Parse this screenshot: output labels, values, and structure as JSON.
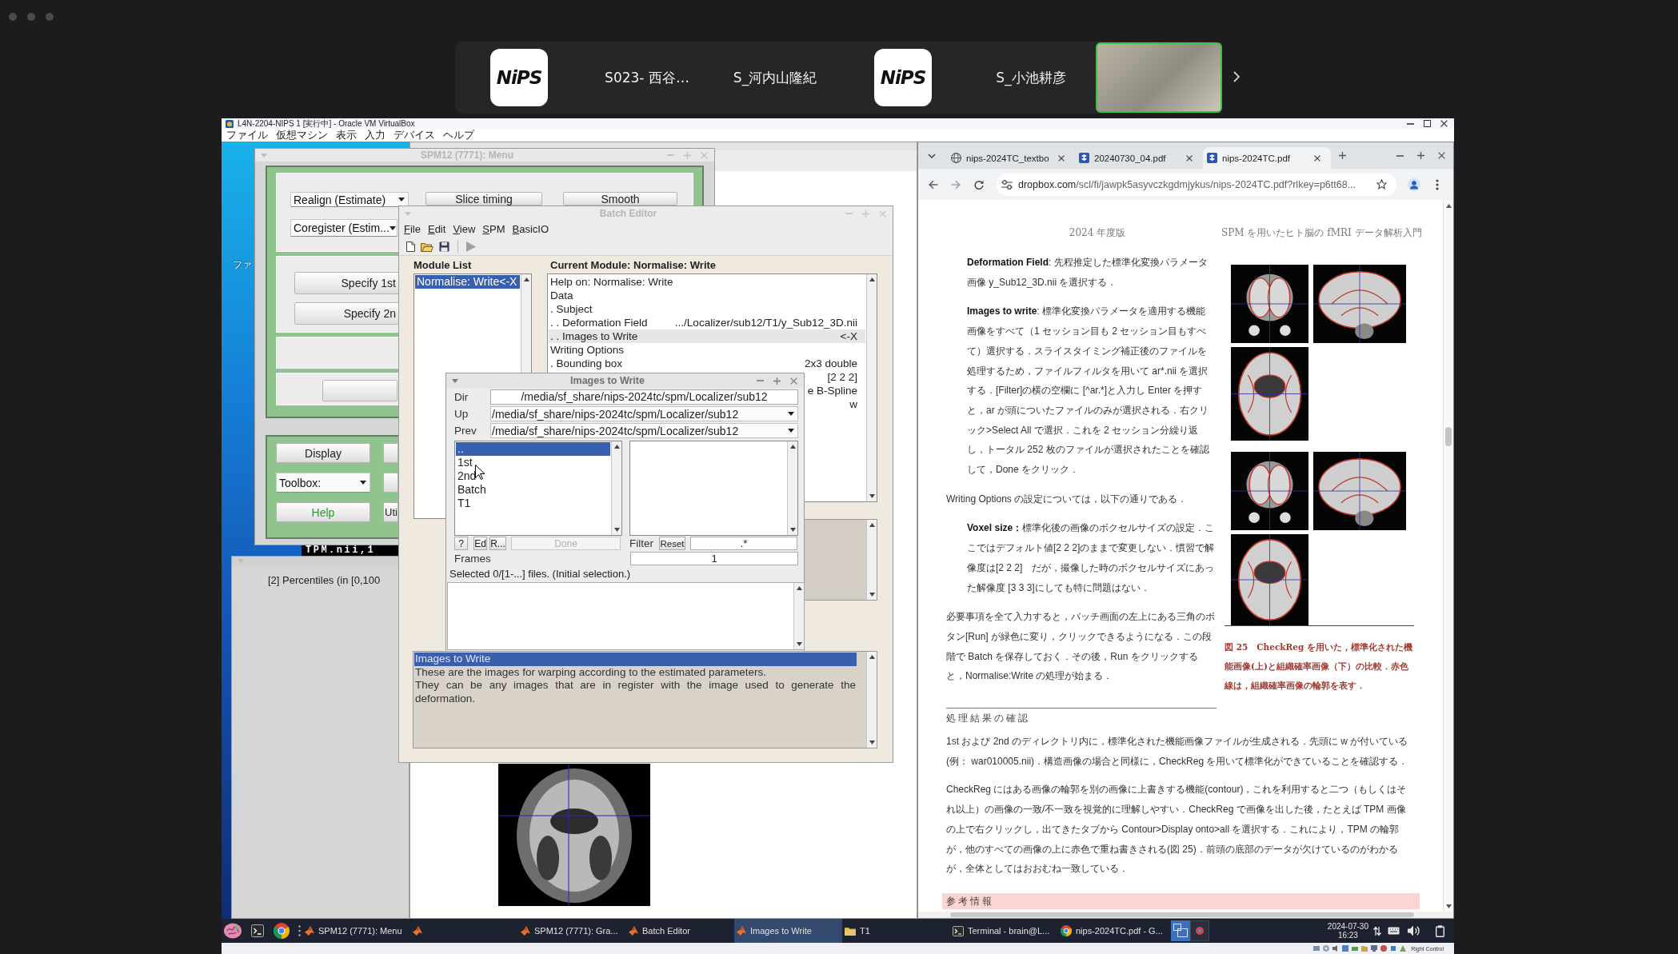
{
  "meeting": {
    "tiles": [
      {
        "kind": "logo",
        "text": "NiPS",
        "speaking": false
      },
      {
        "kind": "name",
        "text": "S023- 西谷…",
        "speaking": false
      },
      {
        "kind": "name",
        "text": "S_河内山隆紀",
        "speaking": false
      },
      {
        "kind": "logo",
        "text": "NiPS",
        "speaking": false
      },
      {
        "kind": "name",
        "text": "S_小池耕彦",
        "speaking": false
      },
      {
        "kind": "video",
        "speaking": true
      }
    ]
  },
  "vm": {
    "title": "L4N-2204-NIPS 1 [実行中] - Oracle VM VirtualBox",
    "menu": [
      "ファイル",
      "仮想マシン",
      "表示",
      "入力",
      "デバイス",
      "ヘルプ"
    ],
    "status": "Right Control"
  },
  "desktop": {
    "icon_label": "ファ"
  },
  "spm_menu": {
    "title": "SPM12 (7771): Menu",
    "panels": [
      {
        "controls": [
          {
            "kind": "dropdown",
            "label": "Realign (Estimate)"
          },
          {
            "kind": "button",
            "label": "Slice timing"
          },
          {
            "kind": "button",
            "label": "Smooth"
          },
          {
            "kind": "dropdown",
            "label": "Coregister (Estim..."
          }
        ]
      },
      {
        "controls": [
          {
            "kind": "button",
            "label": "Specify 1st"
          },
          {
            "kind": "button",
            "label": "Specify 2n"
          }
        ]
      }
    ],
    "tools": [
      {
        "kind": "button",
        "label": "Display"
      },
      {
        "kind": "button"
      },
      {
        "kind": "dropdown",
        "label": "Toolbox:"
      },
      {
        "kind": "button"
      },
      {
        "kind": "accent",
        "label": "Help"
      },
      {
        "kind": "button",
        "label": "Uti"
      }
    ]
  },
  "tpm_label": "TPM.nii,1",
  "percentiles": {
    "prompt": "[2] Percentiles (in [0,100"
  },
  "batch_editor": {
    "title": "Batch Editor",
    "menu": [
      "File",
      "Edit",
      "View",
      "SPM",
      "BasicIO"
    ],
    "run_enabled": false,
    "module_list_label": "Module List",
    "modules": [
      {
        "label": "Normalise: Write<-X",
        "selected": true
      }
    ],
    "current_label": "Current Module: Normalise: Write",
    "items": [
      {
        "label": "Help on: Normalise: Write",
        "selected": false
      },
      {
        "label": "Data",
        "selected": false
      },
      {
        "label": ". Subject",
        "selected": false
      },
      {
        "label": ". . Deformation Field",
        "value": ".../Localizer/sub12/T1/y_Sub12_3D.nii",
        "selected": false
      },
      {
        "label": ". . Images to Write",
        "value": "<-X",
        "selected": true
      },
      {
        "label": "Writing Options",
        "selected": false
      },
      {
        "label": ". Bounding box",
        "value": "2x3 double",
        "selected": false
      },
      {
        "value": "[2 2 2]",
        "selected": false
      },
      {
        "value": "e B-Spline",
        "selected": false
      },
      {
        "value": "w",
        "selected": false
      }
    ],
    "help": [
      {
        "text": "Images to Write",
        "selected": true
      },
      {
        "text": "These are the images for warping according to the estimated parameters.",
        "selected": false
      },
      {
        "text": "They can be any images that are in register with the image used to generate the deformation.",
        "selected": false
      }
    ]
  },
  "file_dialog": {
    "title": "Images to Write",
    "dir_label": "Dir",
    "dir": "/media/sf_share/nips-2024tc/spm/Localizer/sub12",
    "up_label": "Up",
    "up": "/media/sf_share/nips-2024tc/spm/Localizer/sub12",
    "prev_label": "Prev",
    "prev": "/media/sf_share/nips-2024tc/spm/Localizer/sub12",
    "entries": [
      {
        "label": "..",
        "selected": true
      },
      {
        "label": "1st",
        "selected": false
      },
      {
        "label": "2nd",
        "selected": false
      },
      {
        "label": "Batch",
        "selected": false
      },
      {
        "label": "T1",
        "selected": false
      }
    ],
    "buttons": [
      {
        "label": "?",
        "disabled": false
      },
      {
        "label": "Ed",
        "disabled": false
      },
      {
        "label": "R...",
        "disabled": false
      },
      {
        "label": "Done",
        "disabled": true
      }
    ],
    "filter_label": "Filter",
    "reset": "Reset",
    "filter": ".*",
    "frames_label": "Frames",
    "frames": "1",
    "status": "Selected 0/[1-...] files. (Initial selection.)"
  },
  "browser": {
    "tabs": [
      {
        "kind": "web",
        "title": "nips-2024TC_textbo",
        "selected": false
      },
      {
        "kind": "file",
        "title": "20240730_04.pdf",
        "selected": false
      },
      {
        "kind": "file",
        "title": "nips-2024TC.pdf",
        "selected": true
      }
    ],
    "url_host": "dropbox.com",
    "url_path": "/scl/fi/jawpk5asyvczkgdmjykus/nips-2024TC.pdf?rlkey=p6tt68...",
    "pdf": {
      "header_left": "2024 年度版",
      "header_right": "SPM を用いたヒト脳の fMRI データ解析入門",
      "blocks": [
        {
          "kind": "definition",
          "term": "Deformation Field",
          "body": ": 先程推定した標準化変換パラメータ画像 y_Sub12_3D.nii を選択する．"
        },
        {
          "kind": "definition",
          "term": "Images to write",
          "body": ": 標準化変換パラメータを適用する機能画像をすべて（1 セッション目も 2 セッション目もすべて）選択する．スライスタイミング補正後のファイルを処理するため，ファイルフィルタを用いて ar*.nii を選択する．[Filter]の横の空欄に [^ar.*]と入力し Enter を押すと，ar が頭についたファイルのみが選択される．右クリック>Select All で選択．これを 2 セッション分繰り返し，トータル 252 枚のファイルが選択されたことを確認して，Done をクリック．"
        },
        {
          "kind": "paragraph",
          "body": "Writing Options の設定については，以下の通りである．"
        },
        {
          "kind": "definition",
          "term": "Voxel size：",
          "body": "標準化後の画像のボクセルサイズの設定．ここではデフォルト値[2 2 2]のままで変更しない．慣習で解像度は[2 2 2]　だが，撮像した時のボクセルサイズにあった解像度 [3 3 3]にしても特に問題はない．"
        },
        {
          "kind": "paragraph",
          "body": "必要事項を全て入力すると，バッチ画面の左上にある三角のボタン[Run] が緑色に変り，クリックできるようになる．この段階で Batch を保存しておく．その後，Run をクリックすると，Normalise:Write の処理が始まる．"
        }
      ],
      "caption": "図 25　CheckReg を用いた，標準化された機能画像(上)と組織確率画像（下）の比較．赤色線は，組織確率画像の輪郭を表す．",
      "section_heading": "処理結果の確認",
      "section_paragraphs": [
        "1st および 2nd のディレクトリ内に，標準化された機能画像ファイルが生成される．先頭に w が付いている(例： war010005.nii)．構造画像の場合と同様に，CheckReg を用いて標準化ができていることを確認する．",
        "CheckReg にはある画像の輪郭を別の画像に上書きする機能(contour)，これを利用すると二つ（もしくはそれ以上）の画像の一致/不一致を視覚的に理解しやすい．CheckReg で画像を出した後，たとえば TPM 画像の上で右クリックし，出てきたタブから Contour>Display onto>all を選択する．これにより，TPM の輪郭が，他のすべての画像の上に赤色で重ね書きされる(図 25)．前頭の底部のデータが欠けているのがわかるが，全体としてはおおむね一致している．"
      ],
      "info_heading": "参考情報"
    }
  },
  "taskbar": {
    "items": [
      {
        "kind": "app",
        "label": "SPM12 (7771): Menu",
        "selected": false
      },
      {
        "kind": "app",
        "selected": false
      },
      {
        "kind": "app",
        "label": "SPM12 (7771): Gra...",
        "selected": false
      },
      {
        "kind": "app",
        "label": "Batch Editor",
        "selected": false
      },
      {
        "kind": "app",
        "label": "Images to Write",
        "selected": true
      },
      {
        "kind": "folder",
        "label": "T1",
        "selected": false
      },
      {
        "kind": "terminal",
        "label": "Terminal - brain@L...",
        "selected": false
      },
      {
        "kind": "browser",
        "label": "nips-2024TC.pdf - G...",
        "selected": false
      }
    ],
    "date": "2024-07-30",
    "time": "16:23"
  }
}
